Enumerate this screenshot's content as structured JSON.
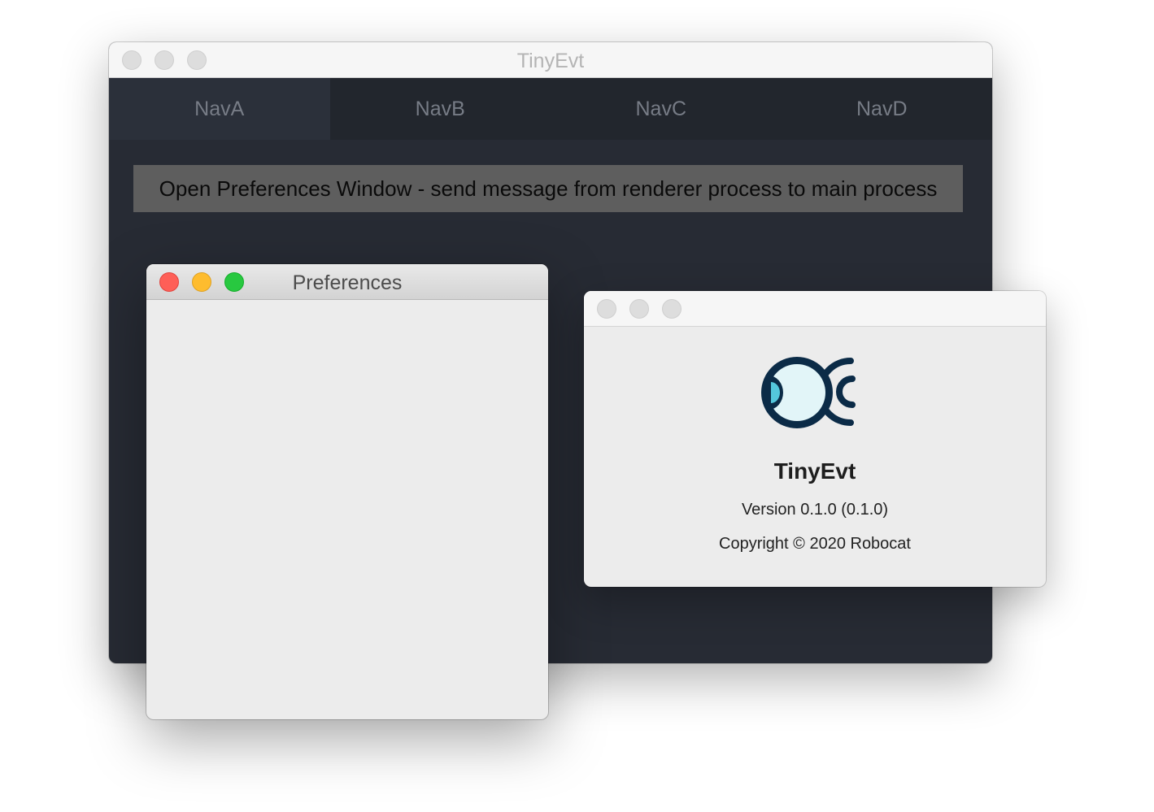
{
  "main_window": {
    "title": "TinyEvt",
    "nav": {
      "tabs": [
        {
          "label": "NavA",
          "active": true
        },
        {
          "label": "NavB",
          "active": false
        },
        {
          "label": "NavC",
          "active": false
        },
        {
          "label": "NavD",
          "active": false
        }
      ]
    },
    "open_prefs_button_label": "Open Preferences Window - send message from renderer process to main process"
  },
  "preferences_window": {
    "title": "Preferences"
  },
  "about_window": {
    "app_name": "TinyEvt",
    "version": "Version 0.1.0 (0.1.0)",
    "copyright": "Copyright © 2020 Robocat",
    "logo_icon": "eye-logo-icon"
  },
  "colors": {
    "main_bg": "#272b34",
    "nav_bg": "#22262d",
    "nav_active_bg": "#2b303a",
    "button_bg": "#5e5e5e",
    "logo_dark": "#0b2b47",
    "logo_light": "#e2f5f8",
    "logo_accent": "#54c7dc"
  }
}
